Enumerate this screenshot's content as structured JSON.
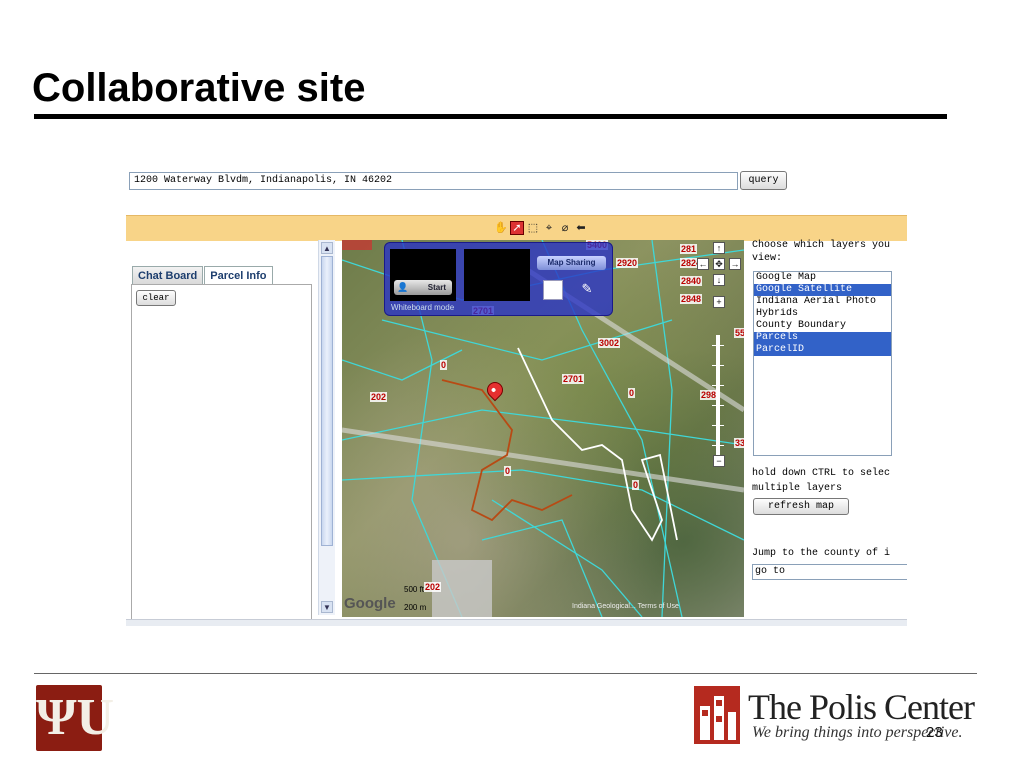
{
  "slide": {
    "title": "Collaborative site",
    "page_number": "23"
  },
  "app": {
    "address_value": "1200 Waterway Blvdm, Indianapolis, IN 46202",
    "query_label": "query",
    "toolbar_icons": [
      "hand-pan-icon",
      "select-arrow-icon",
      "zoom-box-icon",
      "info-cursor-icon",
      "eraser-icon",
      "back-icon"
    ],
    "tabs": [
      {
        "label": "Chat Board",
        "active": false
      },
      {
        "label": "Parcel Info",
        "active": true
      }
    ],
    "clear_label": "clear",
    "map": {
      "whiteboard_start": "Start",
      "whiteboard_mode": "Whiteboard mode",
      "map_sharing": "Map Sharing",
      "parcel_labels": [
        "5400",
        "2920",
        "2824",
        "2840",
        "2848",
        "281",
        "2701",
        "3002",
        "2701",
        "202",
        "0",
        "0",
        "0",
        "0",
        "298",
        "33",
        "55",
        "202"
      ],
      "scale_feet": "500 ft",
      "scale_meters": "200 m",
      "google_logo": "Google",
      "copyright": "Indiana Geological... Terms of Use"
    },
    "layers": {
      "prompt": "Choose which layers you view:",
      "prompt_line1": "Choose which layers you",
      "prompt_line2": "view:",
      "options": [
        {
          "label": "Google Map",
          "selected": false
        },
        {
          "label": "Google Satellite",
          "selected": true
        },
        {
          "label": "Indiana Aerial Photo",
          "selected": false
        },
        {
          "label": "Hybrids",
          "selected": false
        },
        {
          "label": "County Boundary",
          "selected": false
        },
        {
          "label": "Parcels",
          "selected": true
        },
        {
          "label": "ParcelID",
          "selected": true
        }
      ],
      "hint_line1": "hold down CTRL to selec",
      "hint_line2": "multiple layers",
      "refresh_label": "refresh map",
      "jump_label": "Jump to the county of i",
      "goto_value": "go to"
    }
  },
  "footer": {
    "iu_mark": "ΨU",
    "org_name": "The Polis Center",
    "tagline": "We bring things into perspective."
  }
}
